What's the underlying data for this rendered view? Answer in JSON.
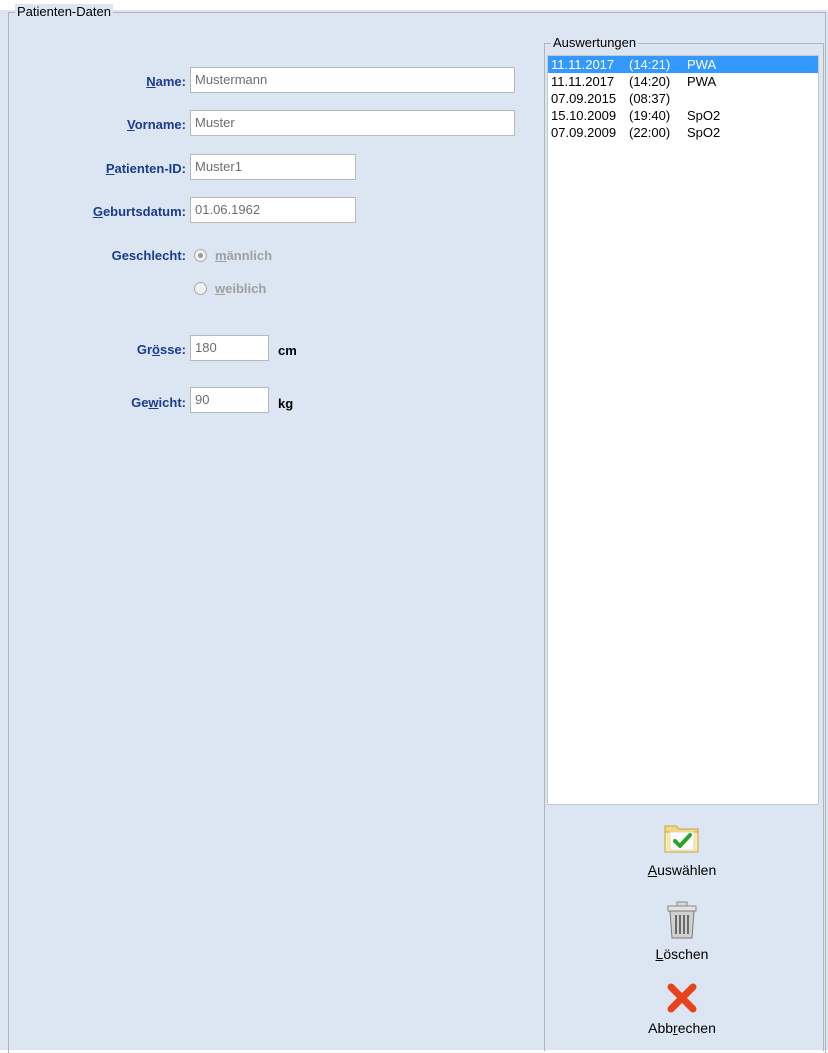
{
  "patient_group": {
    "title": "Patienten-Daten"
  },
  "fields": {
    "name": {
      "label_pre": "",
      "label_u": "N",
      "label_post": "ame:",
      "value": "Mustermann"
    },
    "vorname": {
      "label_pre": "",
      "label_u": "V",
      "label_post": "orname:",
      "value": "Muster"
    },
    "patient_id": {
      "label_pre": "",
      "label_u": "P",
      "label_post": "atienten-ID:",
      "value": "Muster1"
    },
    "geburtsdatum": {
      "label_pre": "",
      "label_u": "G",
      "label_post": "eburtsdatum:",
      "value": "01.06.1962"
    },
    "groesse": {
      "label_pre": "Gr",
      "label_u": "ö",
      "label_post": "sse:",
      "value": "180",
      "unit": "cm"
    },
    "gewicht": {
      "label_pre": "Ge",
      "label_u": "w",
      "label_post": "icht:",
      "value": "90",
      "unit": "kg"
    }
  },
  "geschlecht": {
    "label": "Geschlecht:",
    "options": [
      {
        "label_u": "m",
        "label_post": "ännlich",
        "checked": true
      },
      {
        "label_u": "w",
        "label_post": "eiblich",
        "checked": false
      }
    ]
  },
  "auswertungen": {
    "title": "Auswertungen",
    "rows": [
      {
        "date": "11.11.2017",
        "time": "(14:21)",
        "type": "PWA",
        "selected": true
      },
      {
        "date": "11.11.2017",
        "time": "(14:20)",
        "type": "PWA",
        "selected": false
      },
      {
        "date": "07.09.2015",
        "time": "(08:37)",
        "type": "",
        "selected": false
      },
      {
        "date": "15.10.2009",
        "time": "(19:40)",
        "type": "SpO2",
        "selected": false
      },
      {
        "date": "07.09.2009",
        "time": "(22:00)",
        "type": "SpO2",
        "selected": false
      }
    ]
  },
  "buttons": {
    "auswaehlen": {
      "label_pre": "",
      "label_u": "A",
      "label_post": "uswählen",
      "icon": "folder-check-icon"
    },
    "loeschen": {
      "label_pre": "",
      "label_u": "L",
      "label_post": "öschen",
      "icon": "trash-icon"
    },
    "abbrechen": {
      "label_pre": "Abb",
      "label_u": "r",
      "label_post": "echen",
      "icon": "close-icon"
    }
  },
  "colors": {
    "background": "#dbe6f2",
    "label_blue": "#1a3b8f",
    "selection": "#3399ff",
    "cancel_red": "#e8431a",
    "check_green": "#2aa52a"
  }
}
